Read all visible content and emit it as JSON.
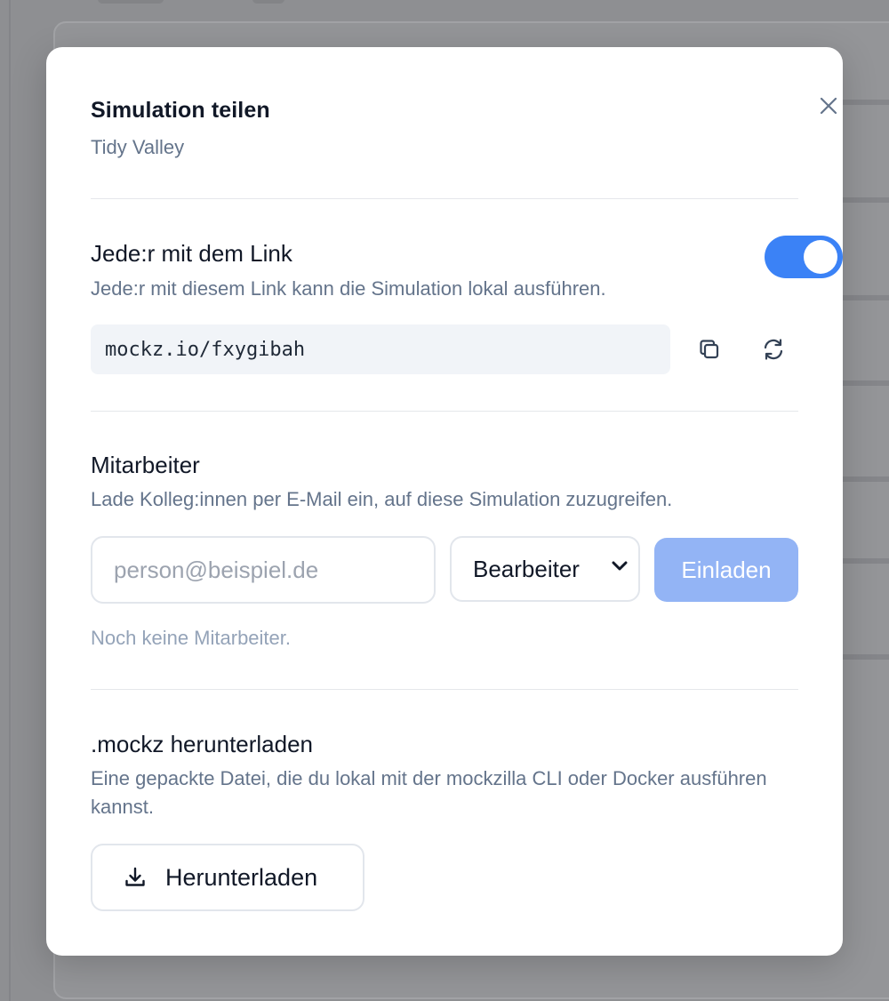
{
  "modal": {
    "title": "Simulation teilen",
    "subtitle": "Tidy Valley"
  },
  "link_section": {
    "title": "Jede:r mit dem Link",
    "description": "Jede:r mit diesem Link kann die Simulation lokal ausführen.",
    "enabled": true,
    "url": "mockz.io/fxygibah",
    "copy_icon": "copy-icon",
    "regenerate_icon": "refresh-icon"
  },
  "collaborators": {
    "title": "Mitarbeiter",
    "description": "Lade Kolleg:innen per E-Mail ein, auf diese Simulation zuzugreifen.",
    "email_placeholder": "person@beispiel.de",
    "email_value": "",
    "role_selected": "Bearbeiter",
    "invite_label": "Einladen",
    "empty_text": "Noch keine Mitarbeiter."
  },
  "download": {
    "title": ".mockz herunterladen",
    "description": "Eine gepackte Datei, die du lokal mit der mockzilla CLI oder Docker ausführen kannst.",
    "button_label": "Herunterladen",
    "button_icon": "download-icon"
  },
  "colors": {
    "accent": "#3b82f6",
    "accent_disabled": "#93b4f5",
    "overlay": "#8e8f92"
  }
}
